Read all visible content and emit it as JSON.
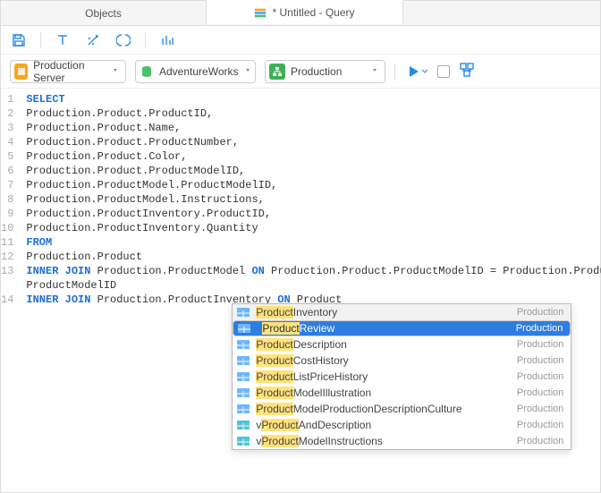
{
  "tabs": {
    "inactive_label": "Objects",
    "active_label": "* Untitled - Query"
  },
  "selectors": {
    "server": "Production Server",
    "database": "AdventureWorks",
    "schema": "Production"
  },
  "code": {
    "lines": [
      {
        "n": "1",
        "pre": "",
        "kw": "SELECT",
        "post": ""
      },
      {
        "n": "2",
        "pre": "Production.Product.ProductID,",
        "kw": "",
        "post": ""
      },
      {
        "n": "3",
        "pre": "Production.Product.Name,",
        "kw": "",
        "post": ""
      },
      {
        "n": "4",
        "pre": "Production.Product.ProductNumber,",
        "kw": "",
        "post": ""
      },
      {
        "n": "5",
        "pre": "Production.Product.Color,",
        "kw": "",
        "post": ""
      },
      {
        "n": "6",
        "pre": "Production.Product.ProductModelID,",
        "kw": "",
        "post": ""
      },
      {
        "n": "7",
        "pre": "Production.ProductModel.ProductModelID,",
        "kw": "",
        "post": ""
      },
      {
        "n": "8",
        "pre": "Production.ProductModel.Instructions,",
        "kw": "",
        "post": ""
      },
      {
        "n": "9",
        "pre": "Production.ProductInventory.ProductID,",
        "kw": "",
        "post": ""
      },
      {
        "n": "10",
        "pre": "Production.ProductInventory.Quantity",
        "kw": "",
        "post": ""
      },
      {
        "n": "11",
        "pre": "",
        "kw": "FROM",
        "post": ""
      },
      {
        "n": "12",
        "pre": "Production.Product",
        "kw": "",
        "post": ""
      }
    ],
    "l13_kw1": "INNER JOIN",
    "l13_mid": " Production.ProductModel ",
    "l13_kw2": "ON",
    "l13_post": " Production.Product.ProductModelID = Production.ProductModel.",
    "l13_wrap": "ProductModelID",
    "l14_kw1": "INNER JOIN",
    "l14_mid": " Production.ProductInventory ",
    "l14_kw2": "ON",
    "l14_post": " Product",
    "n13": "13",
    "n14": "14"
  },
  "ac": {
    "schema": "Production",
    "rows": [
      {
        "icon": "table",
        "hl": "Product",
        "rest": "Inventory",
        "state": "hover"
      },
      {
        "icon": "table",
        "hl": "Product",
        "rest": "Review",
        "state": "sel"
      },
      {
        "icon": "table",
        "hl": "Product",
        "rest": "Description",
        "state": ""
      },
      {
        "icon": "table",
        "hl": "Product",
        "rest": "CostHistory",
        "state": ""
      },
      {
        "icon": "table",
        "hl": "Product",
        "rest": "ListPriceHistory",
        "state": ""
      },
      {
        "icon": "table",
        "hl": "Product",
        "rest": "ModelIllustration",
        "state": ""
      },
      {
        "icon": "table",
        "hl": "Product",
        "rest": "ModelProductionDescriptionCulture",
        "state": ""
      },
      {
        "icon": "view",
        "hl": "Product",
        "rest": "AndDescription",
        "prefix": "v",
        "state": ""
      },
      {
        "icon": "view",
        "hl": "Product",
        "rest": "ModelInstructions",
        "prefix": "v",
        "state": ""
      }
    ]
  }
}
